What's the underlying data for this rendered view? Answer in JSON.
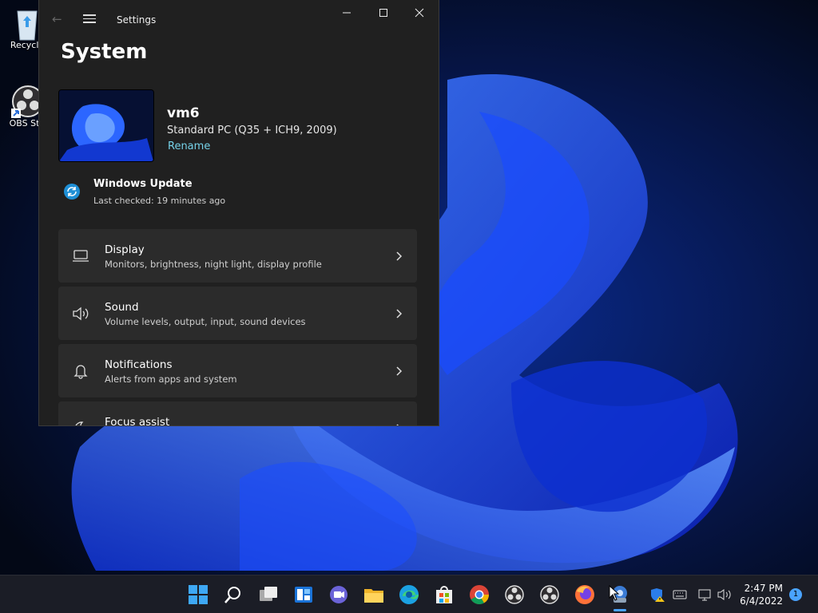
{
  "desktop": {
    "icons": [
      {
        "label": "Recycle",
        "icon": "recycle-bin-icon"
      },
      {
        "label": "OBS Stu",
        "icon": "obs-studio-icon"
      }
    ]
  },
  "window": {
    "title": "Settings",
    "page_title": "System",
    "device": {
      "name": "vm6",
      "spec": "Standard PC (Q35 + ICH9, 2009)",
      "rename": "Rename"
    },
    "update": {
      "title": "Windows Update",
      "subtitle": "Last checked: 19 minutes ago"
    },
    "items": [
      {
        "title": "Display",
        "subtitle": "Monitors, brightness, night light, display profile",
        "icon": "monitor-icon"
      },
      {
        "title": "Sound",
        "subtitle": "Volume levels, output, input, sound devices",
        "icon": "speaker-icon"
      },
      {
        "title": "Notifications",
        "subtitle": "Alerts from apps and system",
        "icon": "bell-icon"
      },
      {
        "title": "Focus assist",
        "subtitle": "",
        "icon": "moon-icon"
      }
    ]
  },
  "taskbar": {
    "apps": [
      "start",
      "search",
      "task-view",
      "widgets",
      "chat",
      "file-explorer",
      "edge",
      "store",
      "chrome",
      "obs",
      "obs",
      "firefox",
      "app"
    ],
    "clock": {
      "time": "2:47 PM",
      "date": "6/4/2022"
    },
    "notification_count": "1"
  },
  "colors": {
    "accent": "#76d2e9",
    "window_bg": "#202020",
    "card_bg": "#2b2b2b",
    "taskbar_bg": "#1b1d26"
  }
}
